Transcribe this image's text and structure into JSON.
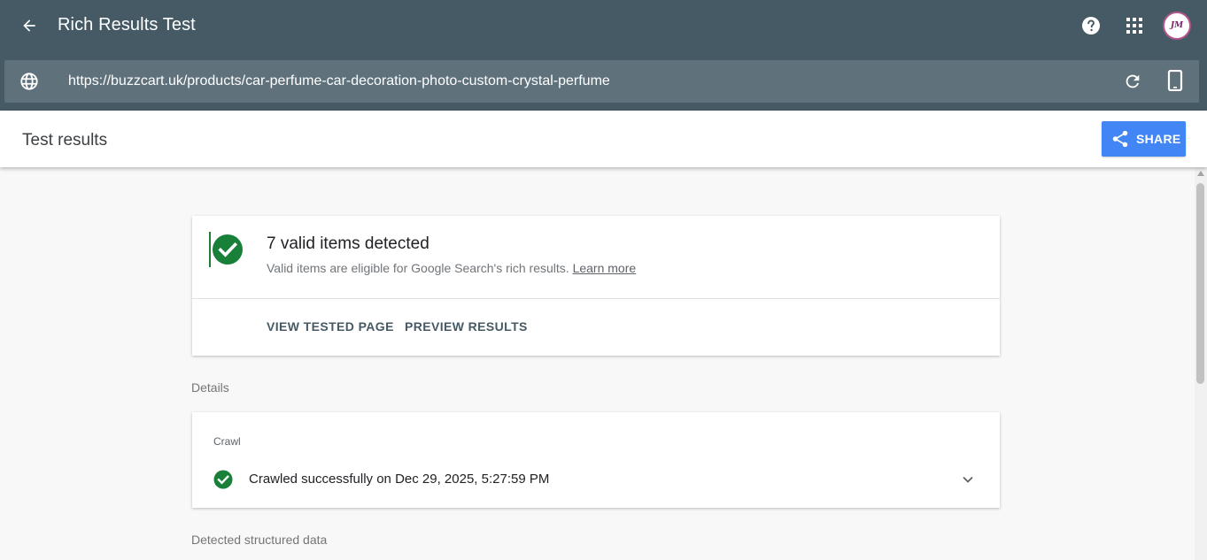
{
  "app": {
    "title": "Rich Results Test",
    "avatar_initials": "JM"
  },
  "url_bar": {
    "url": "https://buzzcart.uk/products/car-perfume-car-decoration-photo-custom-crystal-perfume"
  },
  "results_header": {
    "title": "Test results",
    "share_label": "SHARE"
  },
  "summary": {
    "heading": "7 valid items detected",
    "subtext": "Valid items are eligible for Google Search's rich results.",
    "learn_more": "Learn more",
    "actions": [
      {
        "label": "VIEW TESTED PAGE"
      },
      {
        "label": "PREVIEW RESULTS"
      }
    ]
  },
  "details": {
    "section_label": "Details",
    "crawl": {
      "label": "Crawl",
      "status": "Crawled successfully on Dec 29, 2025, 5:27:59 PM"
    }
  },
  "structured_data": {
    "section_label": "Detected structured data"
  },
  "colors": {
    "app_bar": "#455a64",
    "url_bar": "#5f727c",
    "share_button": "#4285f4",
    "valid_green": "#188038"
  },
  "icons": {
    "back": "arrow-back-icon",
    "help": "help-icon",
    "apps": "apps-grid-icon",
    "globe": "globe-icon",
    "reload": "reload-icon",
    "device": "smartphone-icon",
    "share": "share-icon",
    "valid": "check-circle-icon",
    "expand": "chevron-down-icon"
  }
}
